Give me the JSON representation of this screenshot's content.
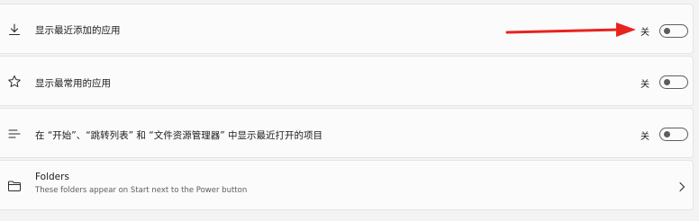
{
  "settings": [
    {
      "icon": "download-icon",
      "label": "显示最近添加的应用",
      "state": "关"
    },
    {
      "icon": "star-icon",
      "label": "显示最常用的应用",
      "state": "关"
    },
    {
      "icon": "jump-list-icon",
      "label": "在 “开始”、“跳转列表” 和 “文件资源管理器” 中显示最近打开的项目",
      "state": "关"
    }
  ],
  "folders": {
    "icon": "folder-icon",
    "title": "Folders",
    "subtitle": "These folders appear on Start next to the Power button"
  },
  "annotation": {
    "color": "#e8231f"
  }
}
